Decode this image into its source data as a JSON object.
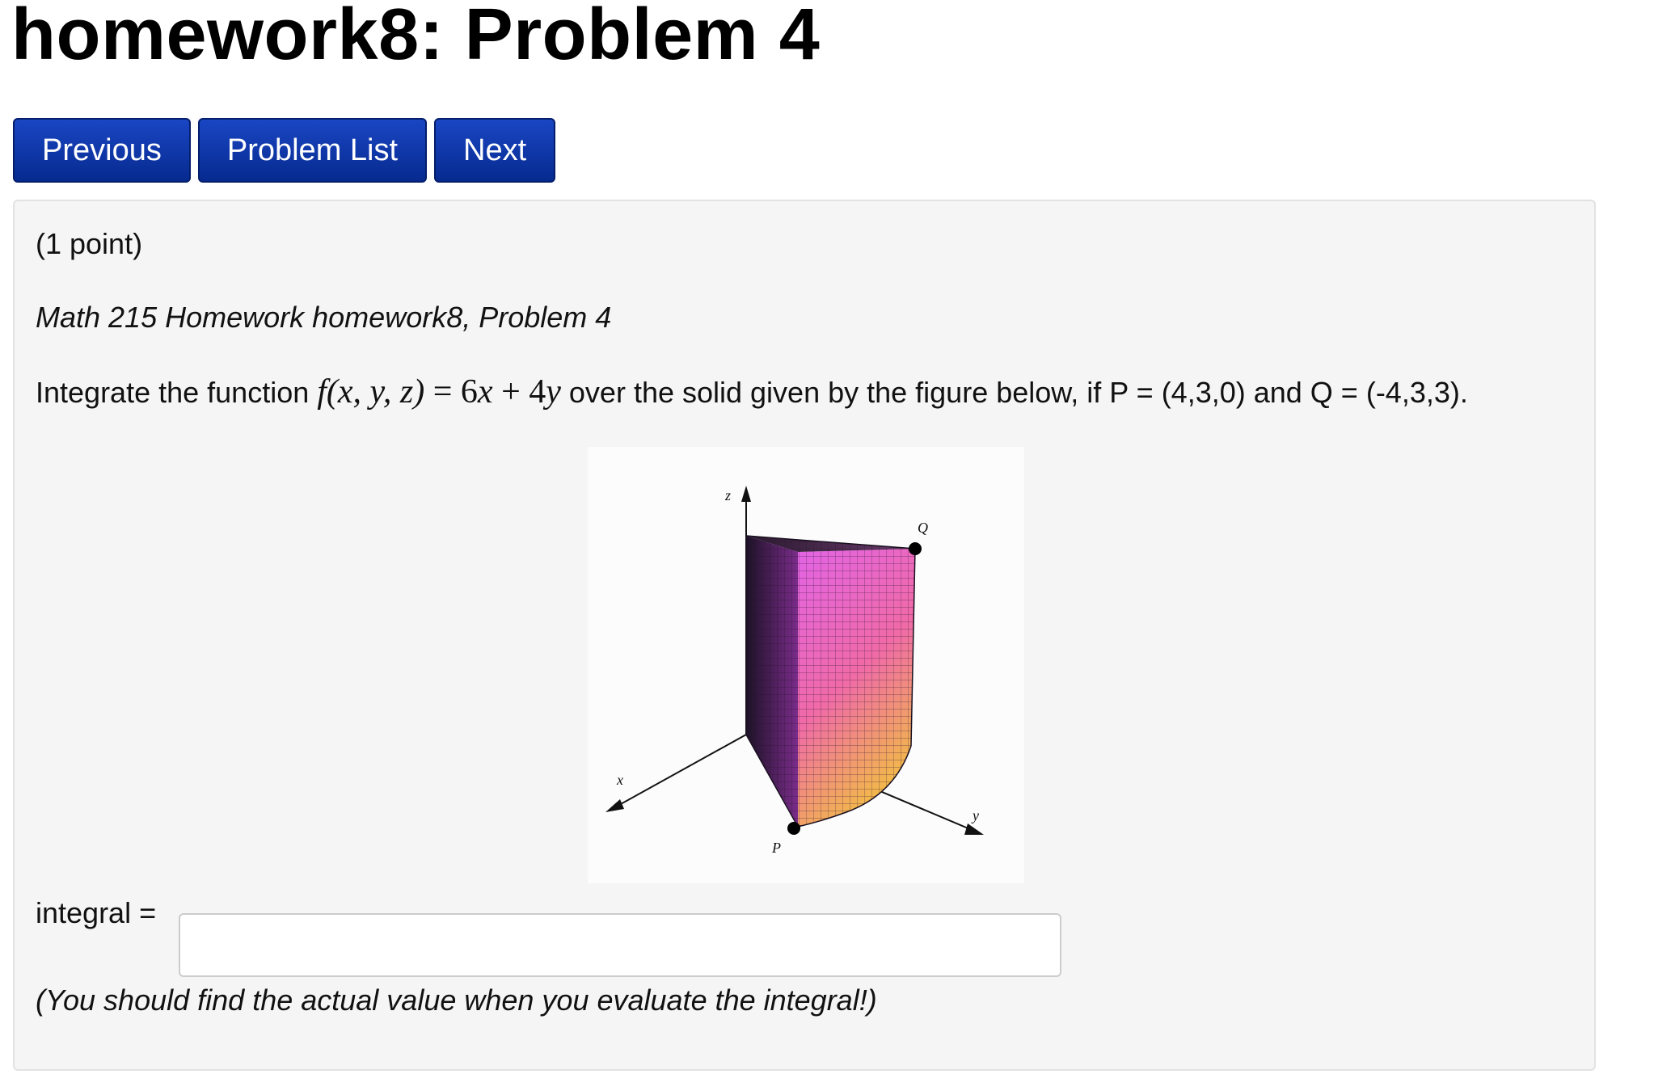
{
  "page": {
    "title": "homework8: Problem 4"
  },
  "nav": {
    "previous_label": "Previous",
    "problem_list_label": "Problem List",
    "next_label": "Next"
  },
  "problem": {
    "points": "(1 point)",
    "course_line": "Math 215 Homework homework8, Problem 4",
    "statement_before": "Integrate the function ",
    "math": {
      "f": "f",
      "args": "(x, y, z)",
      "eq": " = 6",
      "x": "x",
      "plus": " + 4",
      "y": "y"
    },
    "statement_after": " over the solid given by the figure below, if P = (4,3,0) and Q = (-4,3,3).",
    "figure": {
      "axis_labels": {
        "z": "z",
        "x": "x",
        "y": "y"
      },
      "point_labels": {
        "p": "P",
        "q": "Q"
      },
      "surface_colors": [
        "#1a1020",
        "#e060e0",
        "#f06a9a",
        "#f0c040"
      ]
    },
    "answer_label": "integral =",
    "answer_value": "",
    "hint": "(You should find the actual value when you evaluate the integral!)"
  }
}
